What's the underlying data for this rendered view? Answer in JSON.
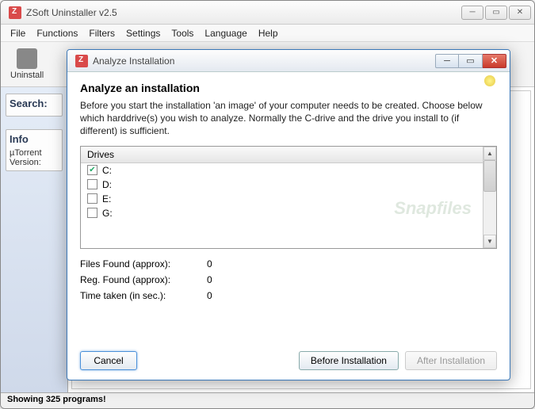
{
  "main": {
    "title": "ZSoft Uninstaller v2.5",
    "menu": [
      "File",
      "Functions",
      "Filters",
      "Settings",
      "Tools",
      "Language",
      "Help"
    ],
    "toolbar": {
      "uninstall": "Uninstall"
    },
    "left": {
      "search_label": "Search:",
      "info_head": "Info",
      "info_line1": "µTorrent",
      "info_line2": "Version:"
    },
    "status": "Showing 325 programs!"
  },
  "dialog": {
    "title": "Analyze Installation",
    "heading": "Analyze an installation",
    "description": "Before you start the installation 'an image' of your computer needs to be created. Choose below which harddrive(s) you wish to analyze. Normally the C-drive and the drive you install to (if different) is sufficient.",
    "drives_header": "Drives",
    "drives": [
      {
        "label": "C:",
        "checked": true
      },
      {
        "label": "D:",
        "checked": false
      },
      {
        "label": "E:",
        "checked": false
      },
      {
        "label": "G:",
        "checked": false
      }
    ],
    "stats": {
      "files_label": "Files Found (approx):",
      "files_val": "0",
      "reg_label": "Reg. Found (approx):",
      "reg_val": "0",
      "time_label": "Time taken (in sec.):",
      "time_val": "0"
    },
    "buttons": {
      "cancel": "Cancel",
      "before": "Before Installation",
      "after": "After Installation"
    }
  },
  "watermark": "Snapfiles"
}
